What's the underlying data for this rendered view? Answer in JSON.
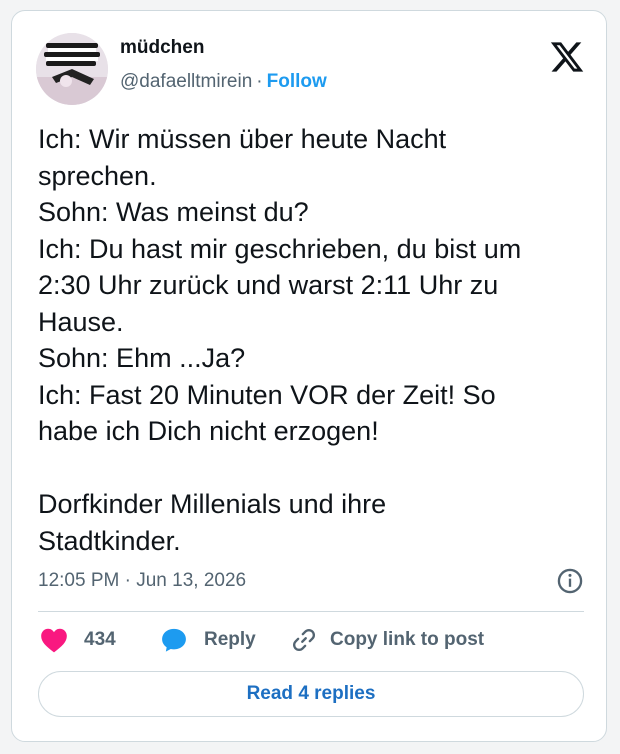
{
  "author": {
    "display_name": "müdchen",
    "handle": "@dafaelltmirein",
    "separator": "·",
    "follow_label": "Follow"
  },
  "tweet": {
    "text": "Ich: Wir müssen über heute Nacht\nsprechen.\nSohn: Was meinst du?\nIch: Du hast mir geschrieben, du bist um\n2:30 Uhr zurück und warst 2:11 Uhr zu\nHause.\nSohn: Ehm ...Ja?\nIch: Fast 20 Minuten VOR der Zeit! So\nhabe ich Dich nicht erzogen!\n\nDorfkinder Millenials und ihre\nStadtkinder.",
    "timestamp": "12:05 PM · Jun 13, 2026"
  },
  "actions": {
    "like_count": "434",
    "reply_label": "Reply",
    "copy_link_label": "Copy link to post"
  },
  "replies_button": {
    "label": "Read 4 replies"
  },
  "icons": {
    "logo": "x-logo-icon",
    "info": "info-icon",
    "like": "heart-icon",
    "reply": "speech-bubble-icon",
    "copy": "link-icon"
  },
  "colors": {
    "like": "#f91880",
    "reply": "#1d9bf0",
    "link_button": "#1d6fc2",
    "text": "#0f1419",
    "muted": "#536471",
    "border": "#cfd9de"
  }
}
